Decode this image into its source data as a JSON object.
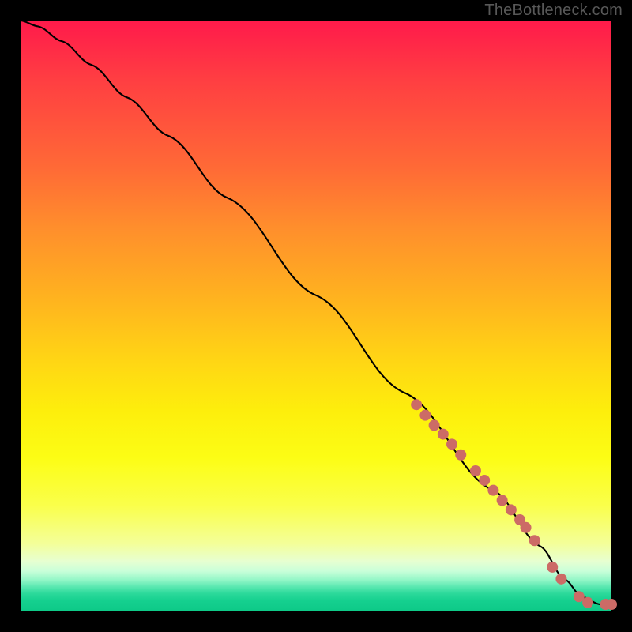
{
  "attribution": "TheBottleneck.com",
  "chart_data": {
    "type": "line",
    "title": "",
    "xlabel": "",
    "ylabel": "",
    "xlim": [
      0,
      100
    ],
    "ylim": [
      0,
      100
    ],
    "grid": false,
    "series": [
      {
        "name": "bottleneck-curve",
        "x": [
          0,
          3,
          7,
          12,
          18,
          25,
          35,
          50,
          65,
          80,
          88,
          92,
          95,
          98,
          100
        ],
        "y": [
          100,
          99,
          96.5,
          92.5,
          87,
          80.5,
          70,
          53.5,
          37,
          20.5,
          11,
          5.5,
          2.5,
          1.2,
          1.2
        ],
        "color": "#000000"
      },
      {
        "name": "highlight-segment",
        "type": "scatter",
        "points": [
          {
            "x": 67.0,
            "y": 35.0
          },
          {
            "x": 68.5,
            "y": 33.2
          },
          {
            "x": 70.0,
            "y": 31.5
          },
          {
            "x": 71.5,
            "y": 30.0
          },
          {
            "x": 73.0,
            "y": 28.3
          },
          {
            "x": 74.5,
            "y": 26.5
          },
          {
            "x": 77.0,
            "y": 23.8
          },
          {
            "x": 78.5,
            "y": 22.2
          },
          {
            "x": 80.0,
            "y": 20.5
          },
          {
            "x": 81.5,
            "y": 18.8
          },
          {
            "x": 83.0,
            "y": 17.2
          },
          {
            "x": 84.5,
            "y": 15.5
          },
          {
            "x": 85.5,
            "y": 14.2
          },
          {
            "x": 87.0,
            "y": 12.0
          },
          {
            "x": 90.0,
            "y": 7.5
          },
          {
            "x": 91.5,
            "y": 5.5
          },
          {
            "x": 94.5,
            "y": 2.5
          },
          {
            "x": 96.0,
            "y": 1.5
          },
          {
            "x": 99.0,
            "y": 1.2
          },
          {
            "x": 100.0,
            "y": 1.2
          }
        ],
        "color": "#cc6b66",
        "marker_radius_px": 7
      }
    ]
  }
}
